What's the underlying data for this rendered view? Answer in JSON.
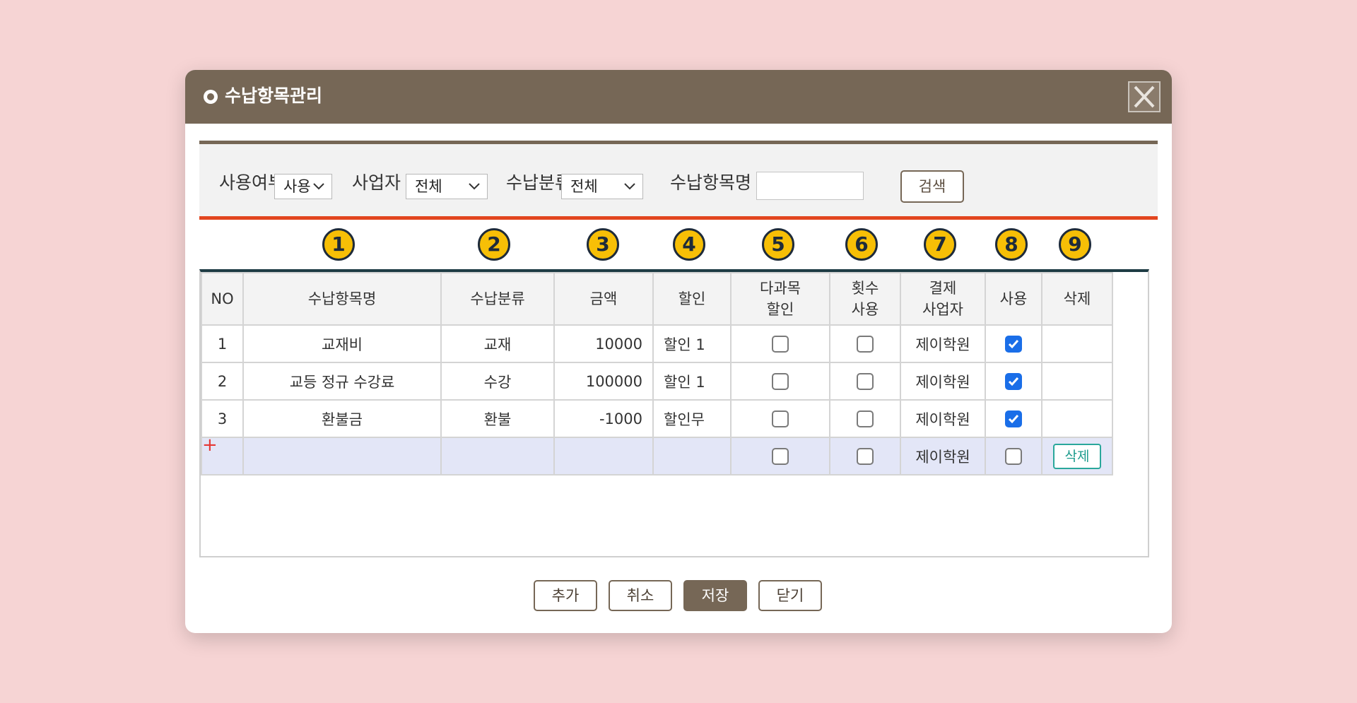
{
  "dialog": {
    "title": "수납항목관리",
    "close_icon": "close-icon"
  },
  "search": {
    "use_label": "사용여부",
    "use_value": "사용",
    "business_label": "사업자",
    "business_value": "전체",
    "category_label": "수납분류",
    "category_value": "전체",
    "item_name_label": "수납항목명",
    "item_name_value": "",
    "search_button": "검색"
  },
  "badges": [
    "1",
    "2",
    "3",
    "4",
    "5",
    "6",
    "7",
    "8",
    "9"
  ],
  "table": {
    "headers": {
      "no": "NO",
      "item_name": "수납항목명",
      "category": "수납분류",
      "amount": "금액",
      "discount": "할인",
      "multi_line1": "다과목",
      "multi_line2": "할인",
      "count_line1": "횟수",
      "count_line2": "사용",
      "pay_line1": "결제",
      "pay_line2": "사업자",
      "use": "사용",
      "delete": "삭제"
    },
    "rows": [
      {
        "no": "1",
        "item_name": "교재비",
        "category": "교재",
        "amount": "10000",
        "discount": "할인 1",
        "multi": false,
        "count": false,
        "payer": "제이학원",
        "use": true
      },
      {
        "no": "2",
        "item_name": "교등 정규 수강료",
        "category": "수강",
        "amount": "100000",
        "discount": "할인 1",
        "multi": false,
        "count": false,
        "payer": "제이학원",
        "use": true
      },
      {
        "no": "3",
        "item_name": "환불금",
        "category": "환불",
        "amount": "-1000",
        "discount": "할인무",
        "multi": false,
        "count": false,
        "payer": "제이학원",
        "use": true
      }
    ],
    "new_row": {
      "marker": "+",
      "payer": "제이학원",
      "delete_label": "삭제"
    }
  },
  "footer": {
    "add": "추가",
    "cancel": "취소",
    "save": "저장",
    "close": "닫기"
  },
  "colors": {
    "title_bar": "#766756",
    "accent_red": "#e2461f",
    "checkbox_on": "#1a6ee8",
    "badge": "#f7bf06"
  }
}
